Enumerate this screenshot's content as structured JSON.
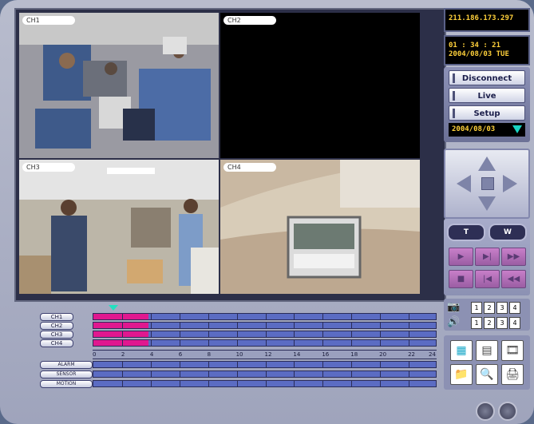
{
  "header": {
    "ip": "211.186.173.297",
    "time": "01 : 34 : 21",
    "datetime": "2004/08/03  TUE"
  },
  "controls": {
    "disconnect": "Disconnect",
    "live": "Live",
    "setup": "Setup",
    "date": "2004/08/03"
  },
  "cameras": [
    {
      "label": "CH1"
    },
    {
      "label": "CH2"
    },
    {
      "label": "CH3"
    },
    {
      "label": "CH4"
    }
  ],
  "playback": {
    "btn1": "T",
    "btn2": "W"
  },
  "num_rows": [
    [
      "1",
      "2",
      "3",
      "4"
    ],
    [
      "1",
      "2",
      "3",
      "4"
    ]
  ],
  "timeline": {
    "channels": [
      "CH1",
      "CH2",
      "CH3",
      "CH4"
    ],
    "events": [
      "ALARM",
      "SENSOR",
      "MOTION"
    ],
    "scale": [
      "0",
      "2",
      "4",
      "6",
      "8",
      "10",
      "12",
      "14",
      "16",
      "18",
      "20",
      "22",
      "24"
    ],
    "record_fraction": 0.16
  },
  "colors": {
    "record": "#e0188f",
    "track": "#5b6cc3",
    "lcd_text": "#ffd13b"
  }
}
